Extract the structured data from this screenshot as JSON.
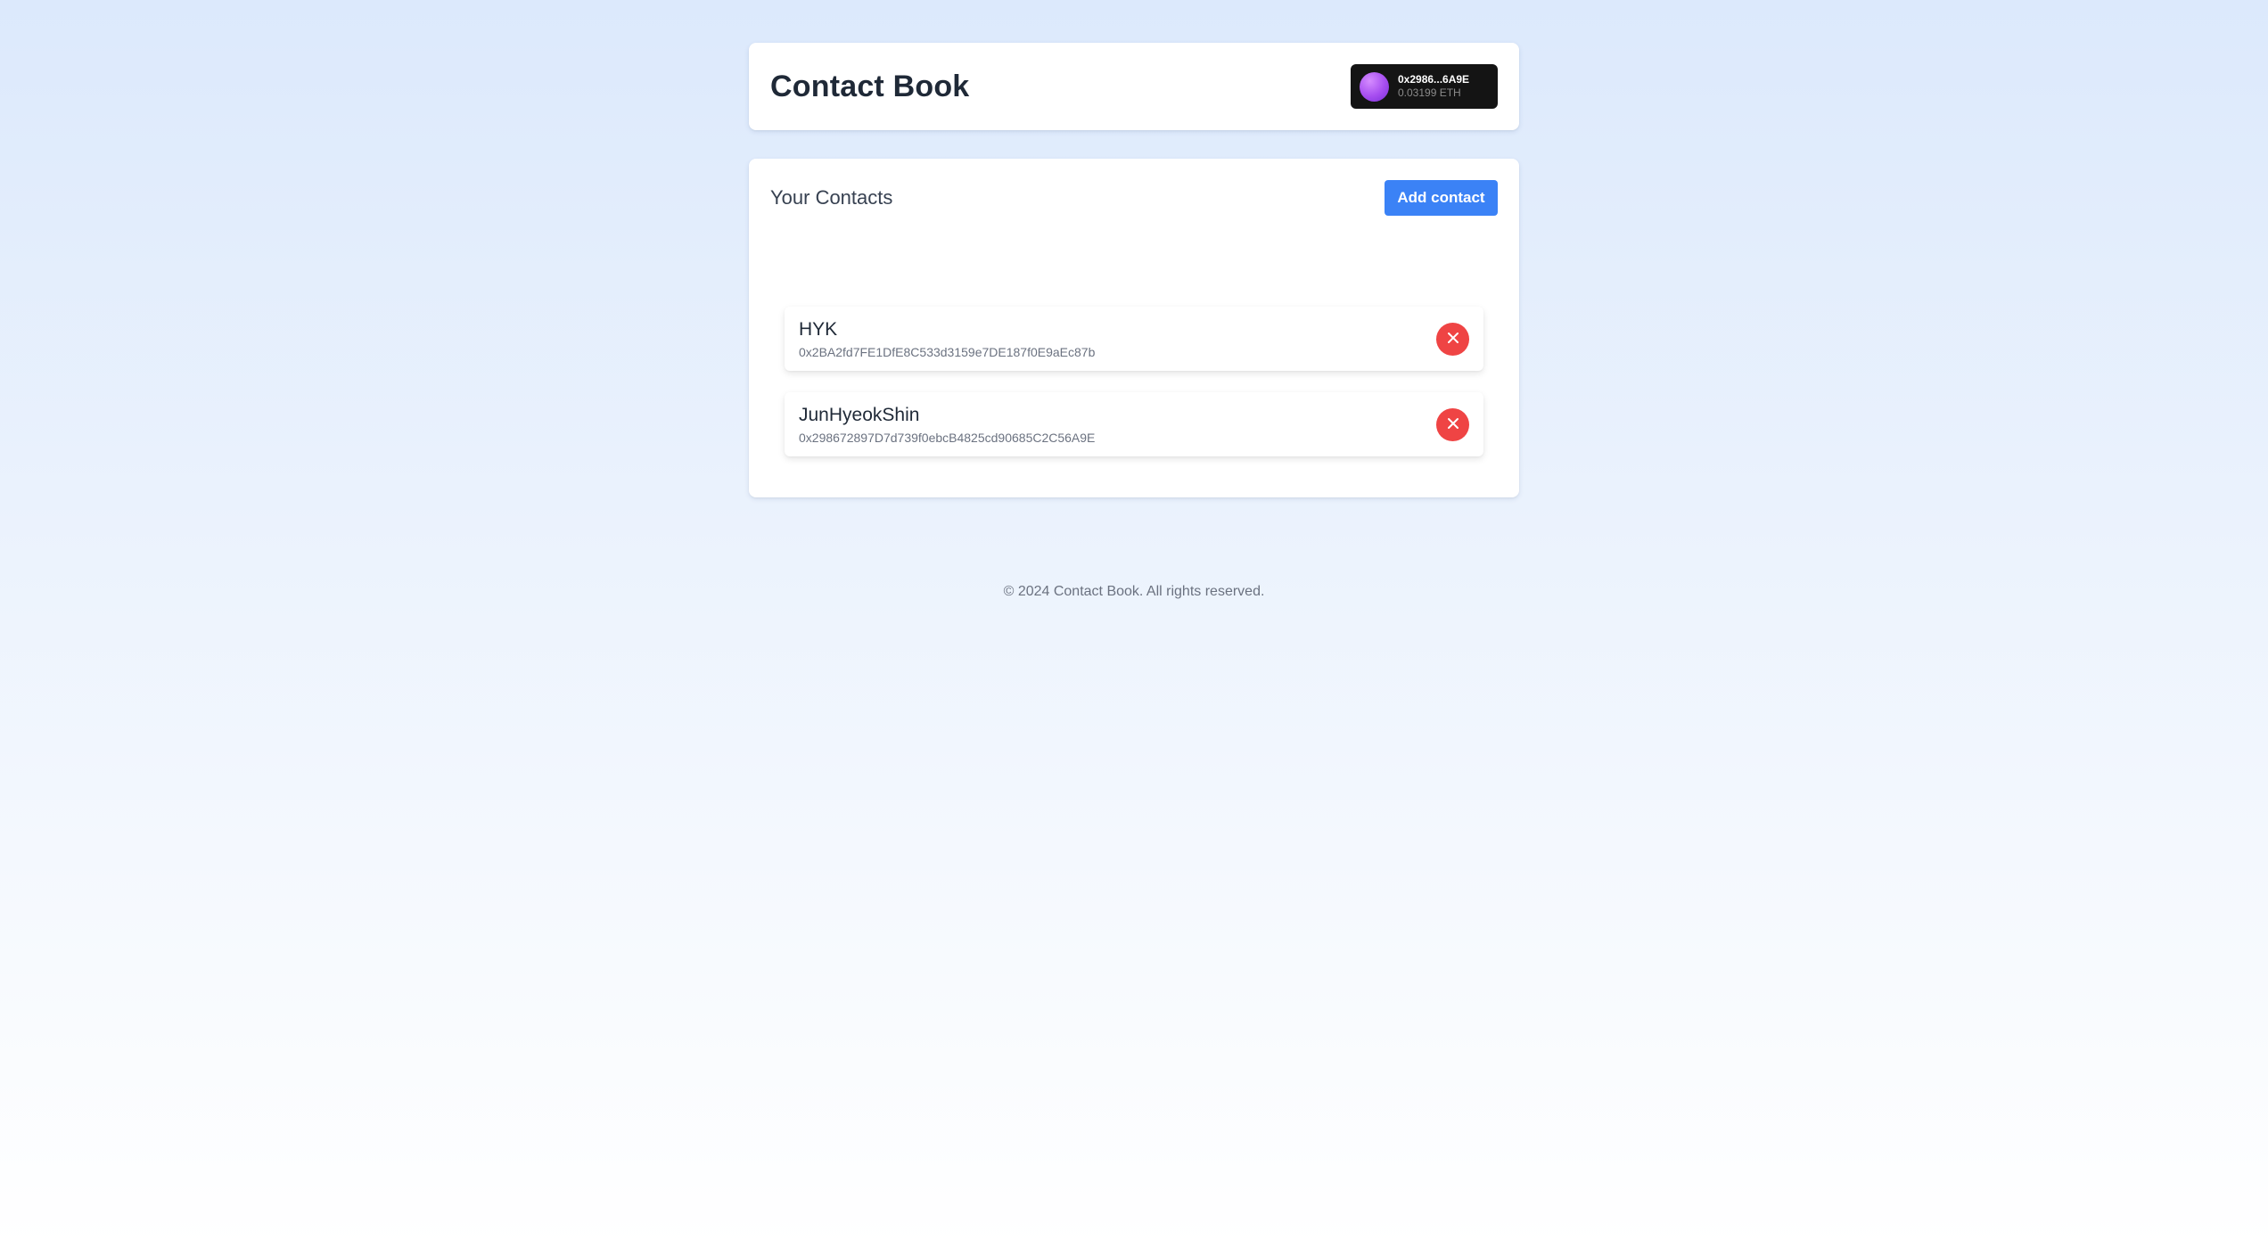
{
  "header": {
    "title": "Contact Book",
    "wallet": {
      "address": "0x2986...6A9E",
      "balance": "0.03199 ETH"
    }
  },
  "contacts_section": {
    "title": "Your Contacts",
    "add_button_label": "Add contact",
    "contacts": [
      {
        "name": "HYK",
        "address": "0x2BA2fd7FE1DfE8C533d3159e7DE187f0E9aEc87b"
      },
      {
        "name": "JunHyeokShin",
        "address": "0x298672897D7d739f0ebcB4825cd90685C2C56A9E"
      }
    ]
  },
  "footer": {
    "text": "© 2024 Contact Book. All rights reserved."
  },
  "colors": {
    "accent": "#3b82f6",
    "danger": "#ef4444",
    "wallet_bg": "#141414"
  },
  "icons": {
    "remove": "close-icon",
    "wallet_avatar": "avatar"
  }
}
